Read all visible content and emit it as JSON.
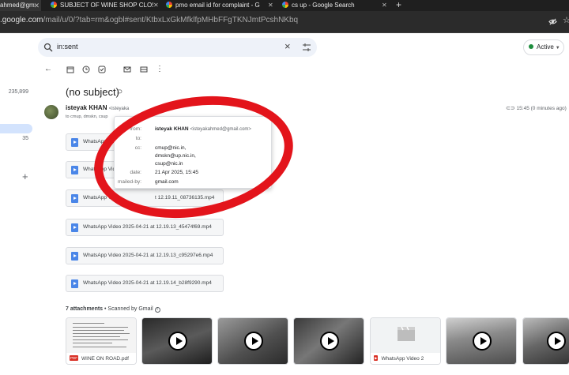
{
  "browser": {
    "tabs": [
      {
        "title": "ahmed@gm",
        "active": true
      },
      {
        "title": "SUBJECT OF WINE SHOP CLOS",
        "active": false
      },
      {
        "title": "pmo email id for complaint - G",
        "active": false
      },
      {
        "title": "cs up - Google Search",
        "active": false
      }
    ],
    "url_host": ".google.com",
    "url_path": "/mail/u/0/?tab=rm&ogbl#sent/KtbxLxGkMfklfpMHbFFgTKNJmtPcshNKbq"
  },
  "search": {
    "query": "in:sent"
  },
  "status": {
    "label": "Active",
    "color": "#1e8e3e"
  },
  "left_rail": {
    "counts": [
      "235,899",
      "35"
    ]
  },
  "message": {
    "subject": "(no subject)",
    "sender_name": "isteyak KHAN",
    "sender_email_short": "<isteyaka",
    "to_line": "to cmup, dmskn, csup",
    "time": "15:45 (0 minutes ago)"
  },
  "details_popup": {
    "from_label": "from:",
    "from_name": "isteyak KHAN",
    "from_email": "<isteyakahmed@gmail.com>",
    "to_label": "to:",
    "cc_label": "cc:",
    "cc": [
      "cmup@nic.in,",
      "dmskn@up.nic.in,",
      "csup@nic.in"
    ],
    "date_label": "date:",
    "date": "21 Apr 2025, 15:45",
    "mailed_by_label": "mailed-by:",
    "mailed_by": "gmail.com"
  },
  "attachment_chips": [
    "WhatsApp Vide",
    "WhatsApp Vid",
    "WhatsApp Video",
    "WhatsApp Video 2025-04-21 at 12.19.13_45474f69.mp4",
    "WhatsApp Video 2025-04-21 at 12.19.13_c95297e6.mp4",
    "WhatsApp Video 2025-04-21 at 12.19.14_b28f9290.mp4"
  ],
  "chip_overlap_text": "t 12.19.11_08736135.mp4",
  "attachments": {
    "count_label": "7 attachments",
    "scanned_label": "• Scanned by Gmail",
    "items": [
      {
        "caption": "WINE ON ROAD.pdf",
        "badge": "PDF",
        "badge_color": "#d93025"
      },
      {
        "caption": "",
        "badge": "",
        "badge_color": ""
      },
      {
        "caption": "",
        "badge": "",
        "badge_color": ""
      },
      {
        "caption": "",
        "badge": "",
        "badge_color": ""
      },
      {
        "caption": "WhatsApp Video 2",
        "badge": "▶",
        "badge_color": "#d93025"
      },
      {
        "caption": "",
        "badge": "",
        "badge_color": ""
      },
      {
        "caption": "",
        "badge": "",
        "badge_color": ""
      }
    ]
  },
  "annotation_color": "#e3141b"
}
